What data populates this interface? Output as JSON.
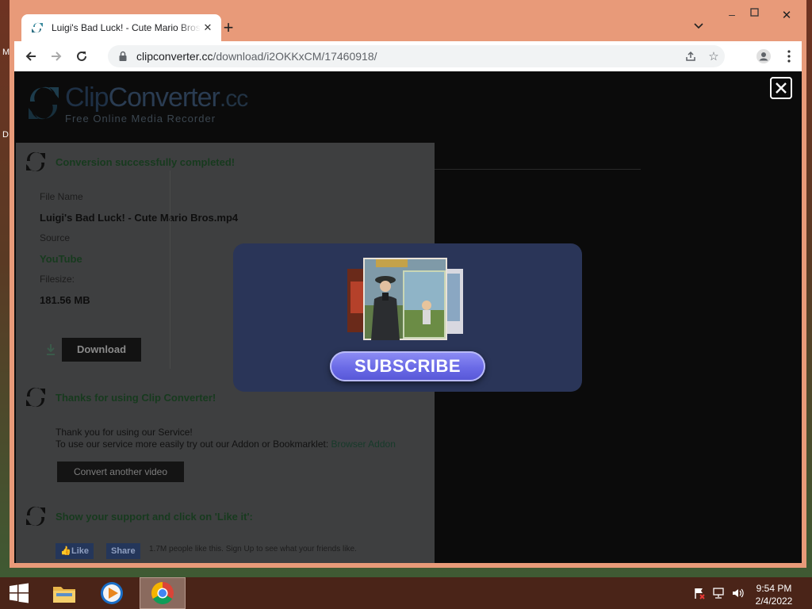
{
  "browser": {
    "tab_title": "Luigi's Bad Luck! - Cute Mario Bros.mp4",
    "url_host": "clipconverter.cc",
    "url_path": "/download/i2OKKxCM/17460918/",
    "window_minimize": "–",
    "window_maximize": "▫",
    "window_close": "✕",
    "new_tab": "+"
  },
  "desktop": {
    "left_labels": [
      "M",
      "D"
    ]
  },
  "site": {
    "logo_part1": "Clip",
    "logo_part2": "Converter",
    "logo_part3": ".cc",
    "tagline": "Free Online Media Recorder",
    "success_title": "Conversion successfully completed!",
    "file_name_label": "File Name",
    "file_name_value": "Luigi's Bad Luck! - Cute Mario Bros.mp4",
    "source_label": "Source",
    "source_value": "YouTube",
    "filesize_label": "Filesize:",
    "filesize_value": "181.56 MB",
    "download_button": "Download",
    "thanks_title": "Thanks for using Clip Converter!",
    "thanks_line1": "Thank you for using our Service!",
    "thanks_line2_prefix": "To use our service more easily try out our Addon or Bookmarklet: ",
    "thanks_line2_link": "Browser Addon",
    "convert_button": "Convert another video",
    "support_title": "Show your support and click on 'Like it':",
    "fb_like": "Like",
    "fb_share": "Share",
    "fb_text": "1.7M people like this. Sign Up to see what your friends like."
  },
  "ad": {
    "subscribe_button": "SUBSCRIBE"
  },
  "taskbar": {
    "time": "9:54 PM",
    "date": "2/4/2022"
  },
  "colors": {
    "window_frame": "#e89a79",
    "taskbar": "#4a2418",
    "subscribe_button": "#6a6ae6",
    "ad_panel": "#2a3558"
  }
}
